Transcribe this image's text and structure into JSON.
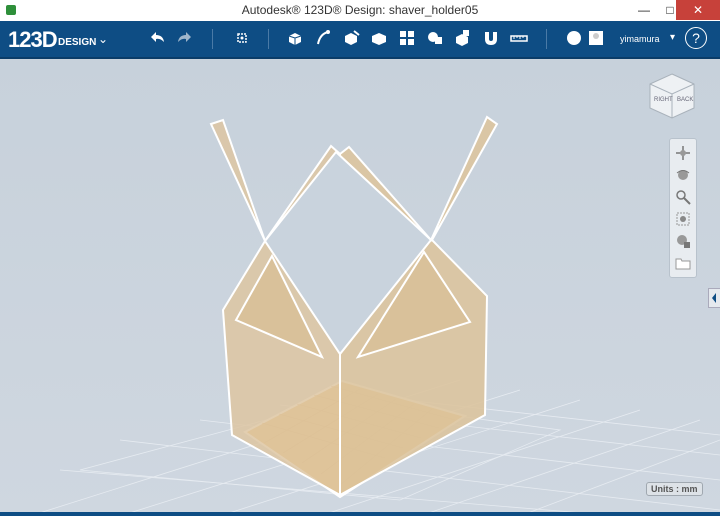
{
  "window": {
    "title": "Autodesk® 123D® Design: shaver_holder05"
  },
  "app": {
    "logo": "123D",
    "logo_sub": "DESIGN"
  },
  "user": {
    "name": "yimamura"
  },
  "help": {
    "label": "?"
  },
  "viewcube": {
    "right": "RIGHT",
    "back": "BACK"
  },
  "status": {
    "units": "Units : mm"
  },
  "colors": {
    "toolbar": "#0e4d84",
    "model": "#e8c58a",
    "viewport": "#c9d3dd"
  }
}
